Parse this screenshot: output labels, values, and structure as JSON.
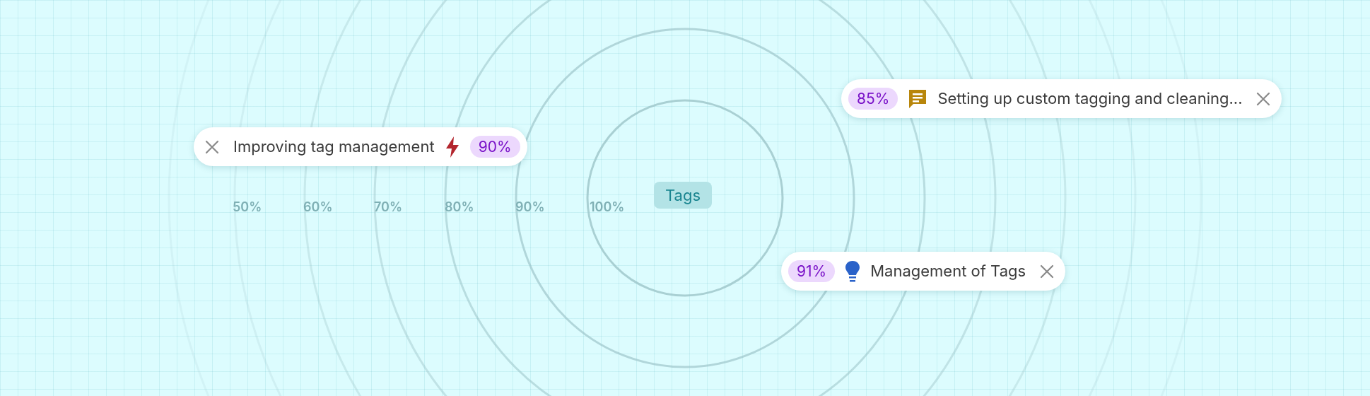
{
  "center_label": "Tags",
  "scale_labels": [
    "50%",
    "60%",
    "70%",
    "80%",
    "90%",
    "100%"
  ],
  "chips": [
    {
      "kind": "close-first",
      "text": "Improving tag management",
      "score": "90%"
    },
    {
      "kind": "score-first",
      "text": "Setting up custom tagging and cleaning...",
      "score": "85%"
    },
    {
      "kind": "score-first",
      "text": "Management of Tags",
      "score": "91%"
    }
  ]
}
